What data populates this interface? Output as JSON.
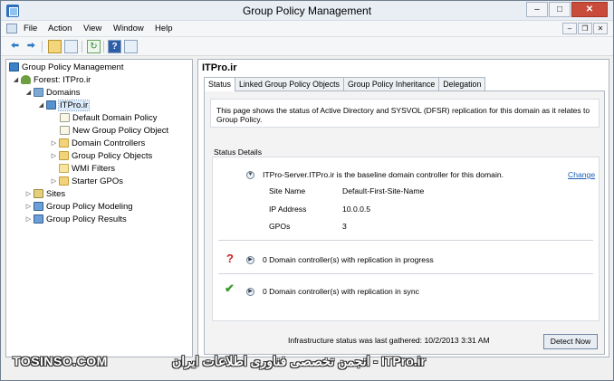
{
  "window": {
    "title": "Group Policy Management"
  },
  "menu": [
    "File",
    "Action",
    "View",
    "Window",
    "Help"
  ],
  "toolbar_icons": [
    "back-arrow-icon",
    "forward-arrow-icon",
    "folder-up-icon",
    "show-hide-tree-icon",
    "refresh-icon",
    "help-icon",
    "properties-icon"
  ],
  "tree": {
    "root": "Group Policy Management",
    "forest": "Forest: ITPro.ir",
    "domains": "Domains",
    "domain": "ITPro.ir",
    "domain_children": [
      "Default Domain Policy",
      "New Group Policy Object",
      "Domain Controllers",
      "Group Policy Objects",
      "WMI Filters",
      "Starter GPOs"
    ],
    "sites": "Sites",
    "modeling": "Group Policy Modeling",
    "results": "Group Policy Results"
  },
  "panel": {
    "title": "ITPro.ir",
    "tabs": [
      "Status",
      "Linked Group Policy Objects",
      "Group Policy Inheritance",
      "Delegation"
    ],
    "description": "This page shows the status of Active Directory and SYSVOL (DFSR) replication for this domain as it relates to Group Policy.",
    "status_details_label": "Status Details",
    "baseline_text": "ITPro-Server.ITPro.ir is the baseline domain controller for this domain.",
    "change_link": "Change",
    "site_name_label": "Site Name",
    "site_name_value": "Default-First-Site-Name",
    "ip_label": "IP Address",
    "ip_value": "10.0.0.5",
    "gpos_label": "GPOs",
    "gpos_value": "3",
    "in_progress_text": "0 Domain controller(s) with replication in progress",
    "in_sync_text": "0 Domain controller(s) with replication in sync",
    "infra_status": "Infrastructure status was last gathered: 10/2/2013 3:31 AM",
    "detect_button": "Detect Now"
  },
  "watermark": {
    "left": "TOSINSO.COM",
    "center": "انجمن تخصصی فناوری اطلاعات ایران - ITPro.ir"
  }
}
